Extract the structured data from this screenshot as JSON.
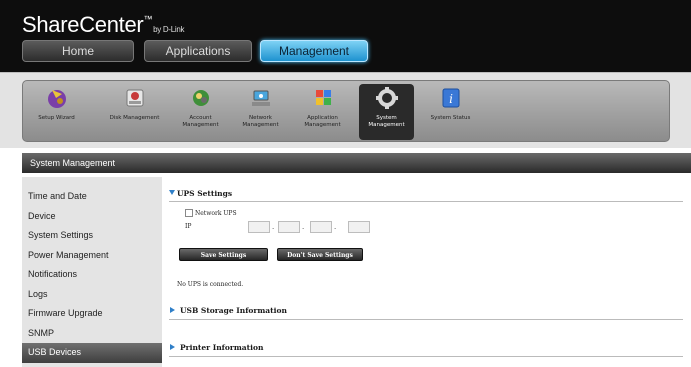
{
  "app": {
    "brand_name": "ShareCenter",
    "brand_tm": "™",
    "brand_by": "by D-Link"
  },
  "nav": {
    "tabs": [
      {
        "label": "Home"
      },
      {
        "label": "Applications"
      },
      {
        "label": "Management"
      }
    ],
    "active_tab": "Management"
  },
  "toolbar": {
    "items": [
      {
        "label": "Setup Wizard",
        "icon": "wizard-icon"
      },
      {
        "label": "Disk Management",
        "icon": "disk-icon"
      },
      {
        "label": "Account Management",
        "icon": "account-icon"
      },
      {
        "label": "Network Management",
        "icon": "network-icon"
      },
      {
        "label": "Application Management",
        "icon": "application-icon"
      },
      {
        "label": "System Management",
        "icon": "system-gear-icon"
      },
      {
        "label": "System Status",
        "icon": "info-icon"
      }
    ],
    "active_item": "System Management"
  },
  "section": {
    "title": "System Management"
  },
  "sidebar": {
    "items": [
      {
        "label": "Time and Date"
      },
      {
        "label": "Device"
      },
      {
        "label": "System Settings"
      },
      {
        "label": "Power Management"
      },
      {
        "label": "Notifications"
      },
      {
        "label": "Logs"
      },
      {
        "label": "Firmware Upgrade"
      },
      {
        "label": "SNMP"
      },
      {
        "label": "USB Devices"
      }
    ],
    "active_item": "USB Devices"
  },
  "main": {
    "ups": {
      "title": "UPS Settings",
      "network_ups_label": "Network UPS",
      "ip_label": "IP",
      "ip_octets": [
        "",
        "",
        "",
        ""
      ],
      "ip_separator": ".",
      "save_label": "Save Settings",
      "dont_save_label": "Don't Save Settings",
      "status_text": "No UPS is connected."
    },
    "usb_storage": {
      "title": "USB Storage Information"
    },
    "printer": {
      "title": "Printer Information"
    }
  },
  "colors": {
    "accent_blue": "#2f7fc8",
    "active_tab": "#1e92cf",
    "header_bg": "#0d0d0d"
  }
}
